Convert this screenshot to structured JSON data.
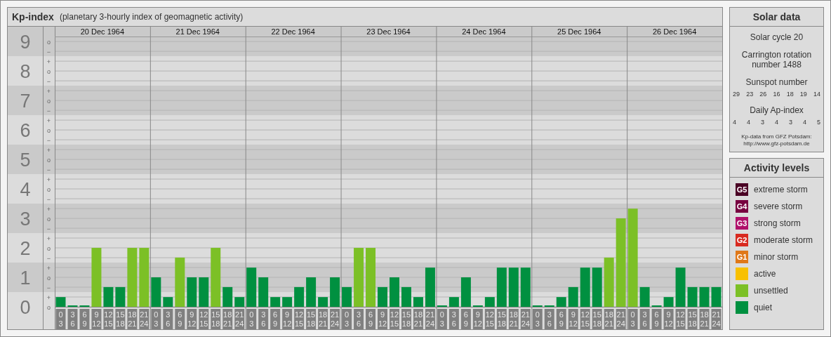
{
  "header": {
    "title": "Kp-index",
    "subtitle": "(planetary 3-hourly index of geomagnetic activity)"
  },
  "chart": {
    "dates": [
      "20 Dec 1964",
      "21 Dec 1964",
      "22 Dec 1964",
      "23 Dec 1964",
      "24 Dec 1964",
      "25 Dec 1964",
      "26 Dec 1964"
    ],
    "minor_ticks": [
      "o",
      "−",
      "+",
      "o",
      "−",
      "+",
      "o",
      "−",
      "+",
      "o",
      "−",
      "+",
      "o",
      "−",
      "+",
      "o",
      "−",
      "+",
      "o",
      "−",
      "+",
      "o",
      "−",
      "+",
      "o",
      "−",
      "+",
      "o"
    ],
    "chart_data": {
      "type": "bar",
      "stacked": true,
      "grid": true,
      "ylim": [
        0,
        9.17
      ],
      "yticks": [
        0,
        1,
        2,
        3,
        4,
        5,
        6,
        7,
        8,
        9
      ],
      "categories": [
        "0\n3",
        "3\n6",
        "6\n9",
        "9\n12",
        "12\n15",
        "15\n18",
        "18\n21",
        "21\n24",
        "0\n3",
        "3\n6",
        "6\n9",
        "9\n12",
        "12\n15",
        "15\n18",
        "18\n21",
        "21\n24",
        "0\n3",
        "3\n6",
        "6\n9",
        "9\n12",
        "12\n15",
        "15\n18",
        "18\n21",
        "21\n24",
        "0\n3",
        "3\n6",
        "6\n9",
        "9\n12",
        "12\n15",
        "15\n18",
        "18\n21",
        "21\n24",
        "0\n3",
        "3\n6",
        "6\n9",
        "9\n12",
        "12\n15",
        "15\n18",
        "18\n21",
        "21\n24",
        "0\n3",
        "3\n6",
        "6\n9",
        "9\n12",
        "12\n15",
        "15\n18",
        "18\n21",
        "21\n24",
        "0\n3",
        "3\n6",
        "6\n9",
        "9\n12",
        "12\n15",
        "15\n18",
        "18\n21",
        "21\n24"
      ],
      "series": [
        {
          "color": "#009040",
          "values": [
            0.33,
            0,
            0,
            null,
            0.67,
            0.67,
            null,
            null,
            1,
            0.33,
            null,
            1,
            1,
            null,
            0.67,
            0.33,
            1.33,
            1,
            0.33,
            0.33,
            0.67,
            1,
            0.33,
            1,
            0.67,
            null,
            null,
            0.67,
            1,
            0.67,
            0.33,
            1.33,
            0,
            0.33,
            1,
            0,
            0.33,
            1.33,
            1.33,
            1.33,
            0,
            0,
            0.33,
            0.67,
            1.33,
            1.33,
            null,
            null,
            null,
            0.67,
            0,
            0.33,
            1.33,
            0.67,
            0.67,
            0.67
          ]
        },
        {
          "color": "#7cc026",
          "values": [
            null,
            null,
            null,
            2,
            null,
            null,
            2,
            2,
            null,
            null,
            1.67,
            null,
            null,
            2,
            null,
            null,
            null,
            null,
            null,
            null,
            null,
            null,
            null,
            null,
            null,
            2,
            2,
            null,
            null,
            null,
            null,
            null,
            null,
            null,
            null,
            null,
            null,
            null,
            null,
            null,
            null,
            null,
            null,
            null,
            null,
            null,
            1.67,
            3,
            3.33,
            null,
            null,
            null,
            null,
            null,
            null,
            null
          ]
        }
      ]
    }
  },
  "solar_data": {
    "title": "Solar data",
    "solar_cycle": "Solar cycle 20",
    "carrington": "Carrington rotation number 1488",
    "sunspot_title": "Sunspot number",
    "sunspot_values": [
      "29",
      "23",
      "26",
      "16",
      "18",
      "19",
      "14"
    ],
    "ap_title": "Daily Ap-index",
    "ap_values": [
      "4",
      "4",
      "3",
      "4",
      "3",
      "4",
      "5"
    ],
    "credit": [
      "Kp-data from GFZ Potsdam:",
      "http://www.gfz-potsdam.de"
    ]
  },
  "activity_levels": {
    "title": "Activity levels",
    "items": [
      {
        "badge": "G5",
        "label": "extreme storm",
        "color": "#4a0024"
      },
      {
        "badge": "G4",
        "label": "severe storm",
        "color": "#780040"
      },
      {
        "badge": "G3",
        "label": "strong storm",
        "color": "#b0106a"
      },
      {
        "badge": "G2",
        "label": "moderate storm",
        "color": "#d82a20"
      },
      {
        "badge": "G1",
        "label": "minor storm",
        "color": "#e07818"
      },
      {
        "label": "active",
        "color": "#f8c000"
      },
      {
        "label": "unsettled",
        "color": "#7cc026"
      },
      {
        "label": "quiet",
        "color": "#009040"
      }
    ]
  }
}
